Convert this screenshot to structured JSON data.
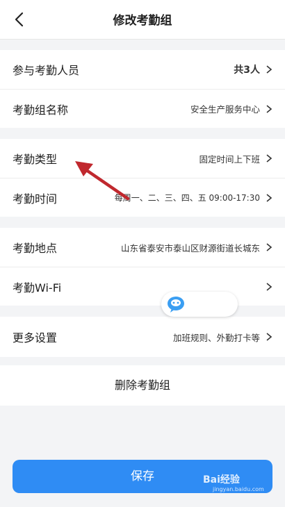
{
  "header": {
    "title": "修改考勤组"
  },
  "group1": [
    {
      "label": "参与考勤人员",
      "value": "共3人"
    },
    {
      "label": "考勤组名称",
      "value": "安全生产服务中心"
    }
  ],
  "group2": [
    {
      "label": "考勤类型",
      "value": "固定时间上下班"
    },
    {
      "label": "考勤时间",
      "value": "每周一、二、三、四、五 09:00-17:30"
    }
  ],
  "group3": [
    {
      "label": "考勤地点",
      "value": "山东省泰安市泰山区财源街道长城东"
    },
    {
      "label": "考勤Wi-Fi",
      "value": ""
    }
  ],
  "group4": [
    {
      "label": "更多设置",
      "value": "加班规则、外勤打卡等"
    }
  ],
  "delete_label": "删除考勤组",
  "save_label": "保存",
  "watermark": {
    "text": "Bai经验",
    "sub": "jingyan.baidu.com"
  },
  "colors": {
    "accent": "#2f8cf4",
    "annotation_arrow": "#c0282e"
  },
  "icons": {
    "back": "chevron-left-icon",
    "row": "chevron-right-icon",
    "chip": "chat-bubble-icon"
  }
}
